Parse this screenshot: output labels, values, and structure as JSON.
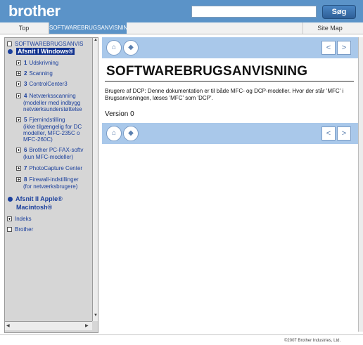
{
  "header": {
    "logo": "brother",
    "search_button": "Søg"
  },
  "tabs": {
    "top": "Top",
    "software": "SOFTWAREBRUGSANVISNING",
    "sitemap": "Site Map"
  },
  "sidebar": {
    "root": "SOFTWAREBRUGSANVIS",
    "section_windows": "Afsnit I Windows®",
    "items": [
      {
        "num": "1",
        "label": "Udskrivning"
      },
      {
        "num": "2",
        "label": "Scanning"
      },
      {
        "num": "3",
        "label": "ControlCenter3"
      },
      {
        "num": "4",
        "label": "Netværksscanning",
        "lines": [
          "(modeller med indbygg",
          "netværksunderstøttelse"
        ]
      },
      {
        "num": "5",
        "label": "Fjernindstilling",
        "lines": [
          "(ikke tilgængelig for DC",
          "modeller, MFC-235C o",
          "MFC-260C)"
        ]
      },
      {
        "num": "6",
        "label": "Brother PC-FAX-softv",
        "lines": [
          "(kun MFC-modeller)"
        ]
      },
      {
        "num": "7",
        "label": "PhotoCapture Center"
      },
      {
        "num": "8",
        "label": "Firewall-indstillinger",
        "lines": [
          "(for netværksbrugere)"
        ]
      }
    ],
    "section_apple": "Afsnit II Apple®",
    "section_apple_2": "Macintosh®",
    "indeks": "Indeks",
    "brother": "Brother"
  },
  "main": {
    "title": "SOFTWAREBRUGSANVISNING",
    "body": "Brugere af DCP: Denne dokumentation er til både MFC- og DCP-modeller. Hvor der står 'MFC' i Brugsanvisningen, læses 'MFC' som 'DCP'.",
    "version": "Version 0"
  },
  "footer": {
    "copyright": "©2007 Brother Industries, Ltd."
  },
  "colors": {
    "header": "#5b93c8",
    "navbar": "#a9c8ea",
    "sidebar": "#d6d6d6",
    "link": "#1a3f9c"
  }
}
